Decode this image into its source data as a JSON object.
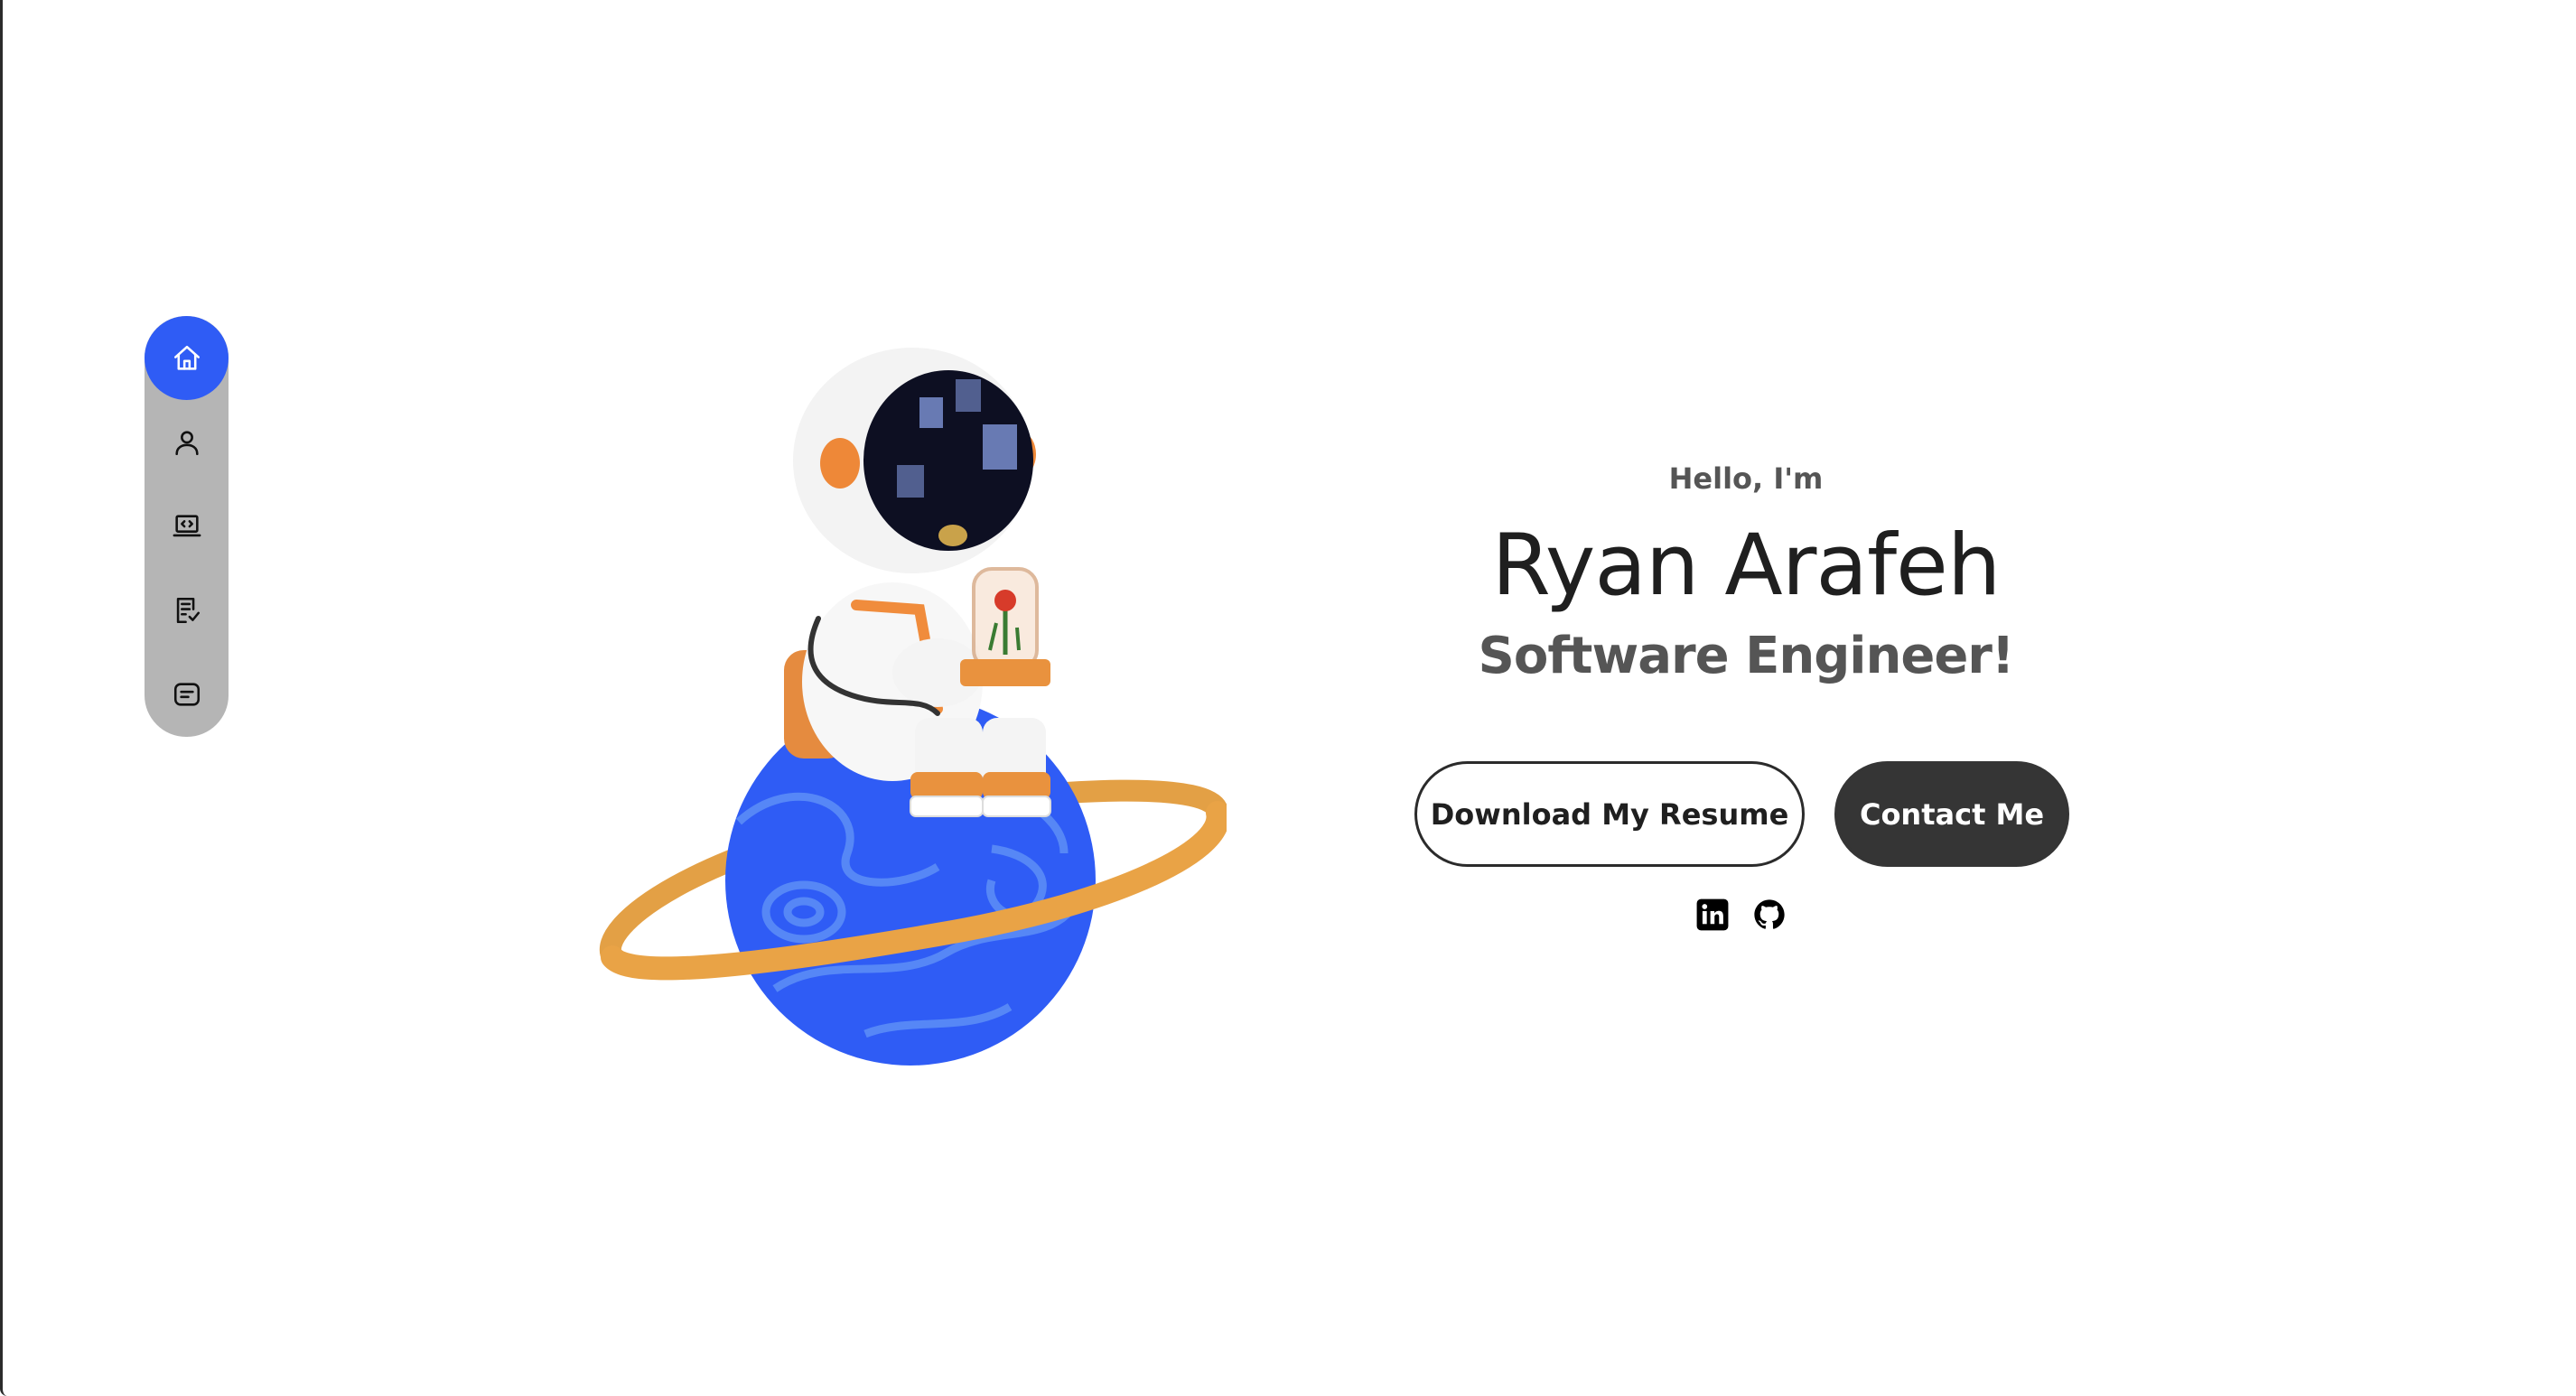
{
  "nav": {
    "items": [
      {
        "icon": "home-icon",
        "active": true
      },
      {
        "icon": "user-icon",
        "active": false
      },
      {
        "icon": "laptop-code-icon",
        "active": false
      },
      {
        "icon": "checklist-icon",
        "active": false
      },
      {
        "icon": "message-icon",
        "active": false
      }
    ],
    "active_color": "#2f5cf5",
    "bar_color": "#b5b5b5"
  },
  "hero": {
    "greeting": "Hello, I'm",
    "name": "Ryan Arafeh",
    "role": "Software Engineer!"
  },
  "actions": {
    "resume_label": "Download My Resume",
    "contact_label": "Contact Me"
  },
  "socials": [
    {
      "icon": "linkedin-icon"
    },
    {
      "icon": "github-icon"
    }
  ],
  "colors": {
    "planet": "#2f5cf5",
    "ring": "#e9a346",
    "button_dark": "#353535"
  }
}
